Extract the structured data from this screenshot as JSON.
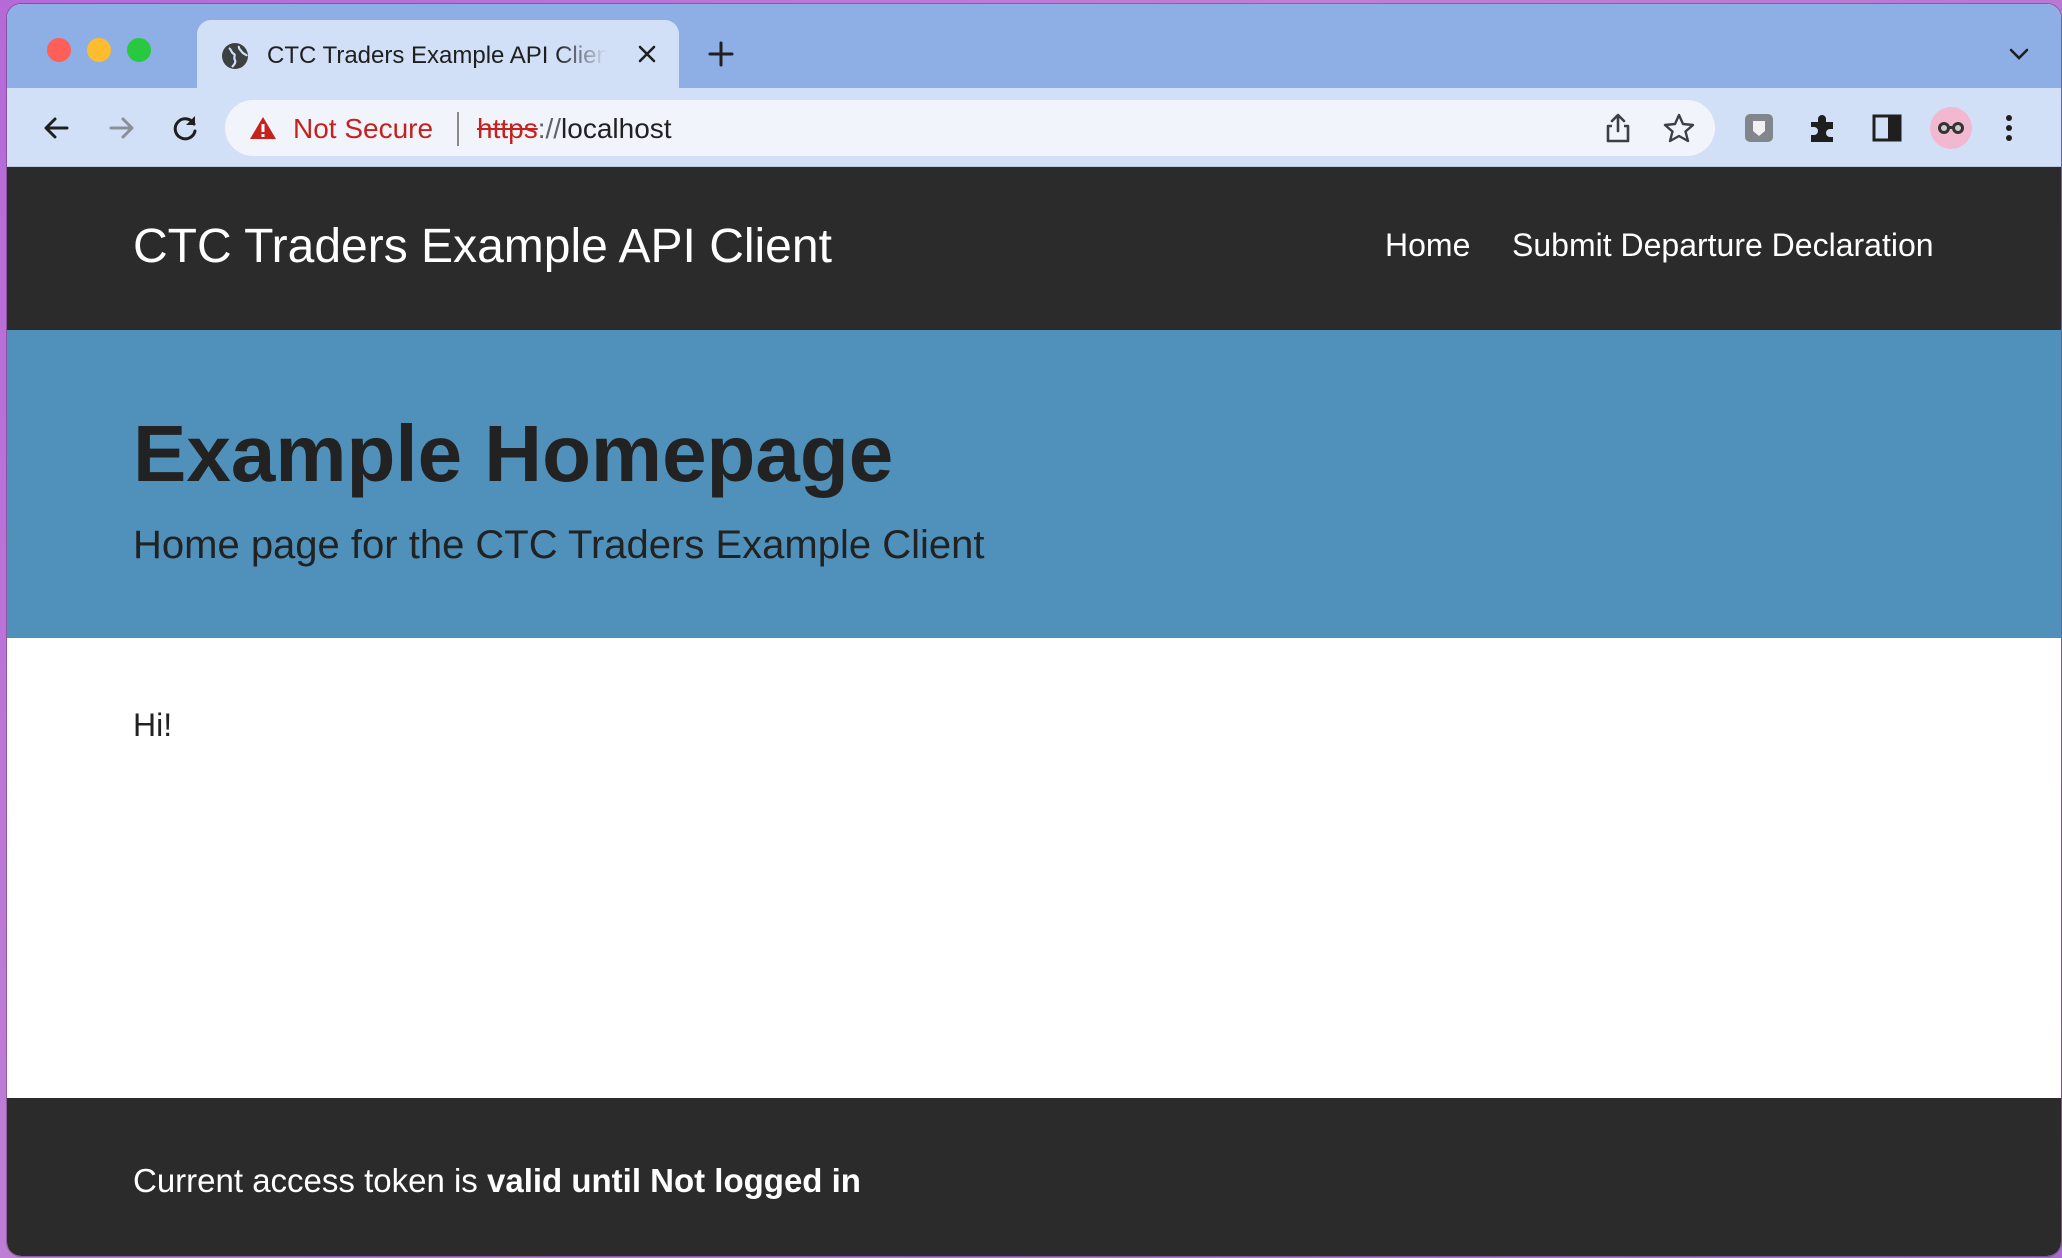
{
  "browser": {
    "tab_title": "CTC Traders Example API Client",
    "security_label": "Not Secure",
    "url_scheme": "https",
    "url_separator": "://",
    "url_host": "localhost"
  },
  "site": {
    "brand": "CTC Traders Example API Client",
    "nav": {
      "home": "Home",
      "submit": "Submit Departure Declaration"
    },
    "hero": {
      "title": "Example Homepage",
      "subtitle": "Home page for the CTC Traders Example Client"
    },
    "content": {
      "greeting": "Hi!"
    },
    "footer": {
      "prefix": "Current access token is",
      "status": "valid until Not logged in"
    }
  },
  "colors": {
    "header_bg": "#2b2b2b",
    "hero_bg": "#4f91bb",
    "tabstrip_bg": "#8eaee6",
    "toolbar_bg": "#d2e0f7",
    "insecure_red": "#c5221f"
  }
}
